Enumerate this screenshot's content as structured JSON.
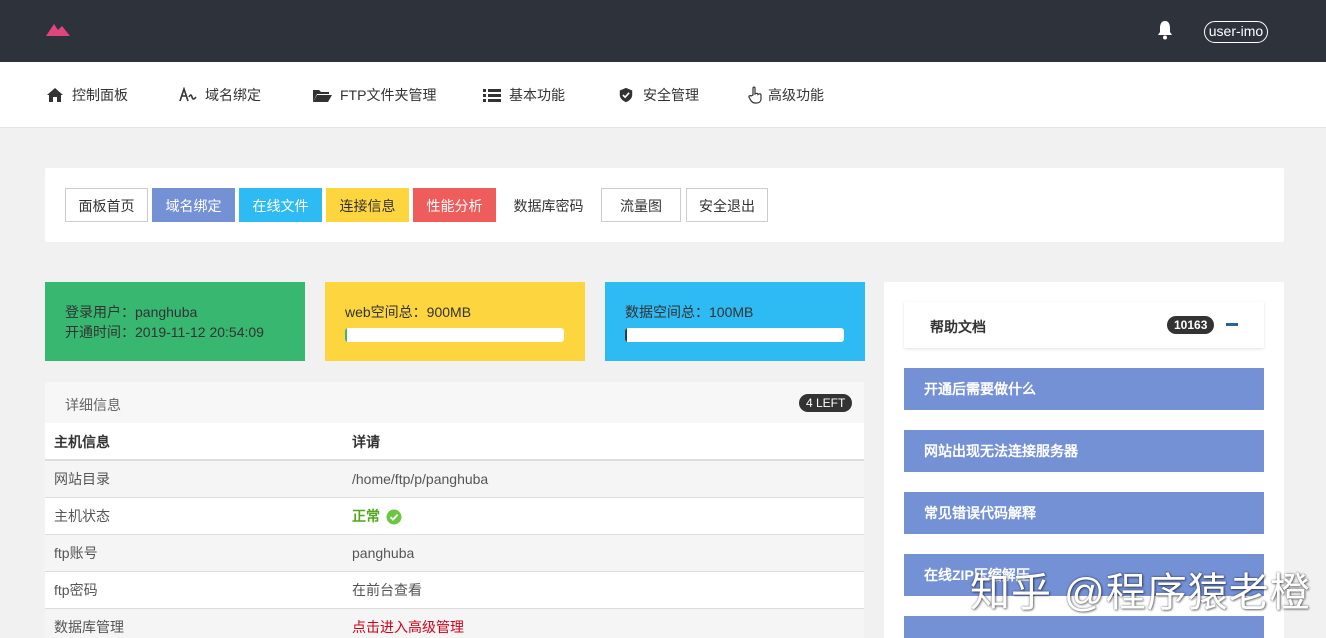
{
  "topbar": {
    "user_label": "user-imo",
    "bg_color": "#2e323b",
    "logo_color": "#e0457b"
  },
  "nav": {
    "items": [
      {
        "label": "控制面板",
        "icon": "home-icon"
      },
      {
        "label": "域名绑定",
        "icon": "signature-icon"
      },
      {
        "label": "FTP文件夹管理",
        "icon": "folder-open-icon"
      },
      {
        "label": "基本功能",
        "icon": "list-icon"
      },
      {
        "label": "安全管理",
        "icon": "shield-icon"
      },
      {
        "label": "高级功能",
        "icon": "hand-pointer-icon"
      }
    ]
  },
  "quick_buttons": [
    {
      "label": "面板首页",
      "style": "plain"
    },
    {
      "label": "域名绑定",
      "color": "#7491d6"
    },
    {
      "label": "在线文件",
      "color": "#2ebaf3"
    },
    {
      "label": "连接信息",
      "color": "#fcd53f",
      "text_color": "#333"
    },
    {
      "label": "性能分析",
      "color": "#ee5d5b"
    },
    {
      "label": "数据库密码",
      "style": "noborder"
    },
    {
      "label": "流量图",
      "style": "plain"
    },
    {
      "label": "安全退出",
      "style": "plain"
    }
  ],
  "cards": {
    "login": {
      "user": "登录用户：panghuba",
      "opened": "开通时间：2019-11-12 20:54:09",
      "color": "#37b76f"
    },
    "web": {
      "label": "web空间总：900MB",
      "usage": 0.01,
      "color": "#fcd53f",
      "fill_color": "#37b76f"
    },
    "db": {
      "label": "数据空间总：100MB",
      "usage": 0.01,
      "color": "#2ebaf3",
      "fill_color": "#2c3e50"
    }
  },
  "info": {
    "title": "详细信息",
    "badge": "4 LEFT",
    "headers": [
      "主机信息",
      "详请"
    ],
    "rows": [
      {
        "key": "网站目录",
        "value": "/home/ftp/p/panghuba"
      },
      {
        "key": "主机状态",
        "value": "正常",
        "value_color": "#52a81c",
        "icon": "check-circle-icon"
      },
      {
        "key": "ftp账号",
        "value": "panghuba"
      },
      {
        "key": "ftp密码",
        "value": "在前台查看"
      },
      {
        "key": "数据库管理",
        "value": "点击进入高级管理",
        "value_color": "#d0021b"
      }
    ]
  },
  "help": {
    "title": "帮助文档",
    "count": "10163",
    "items": [
      "开通后需要做什么",
      "网站出现无法连接服务器",
      "常见错误代码解释",
      "在线ZIP压缩解压"
    ],
    "item_color": "#7491d6"
  },
  "watermark": "知乎 @程序猿老橙"
}
